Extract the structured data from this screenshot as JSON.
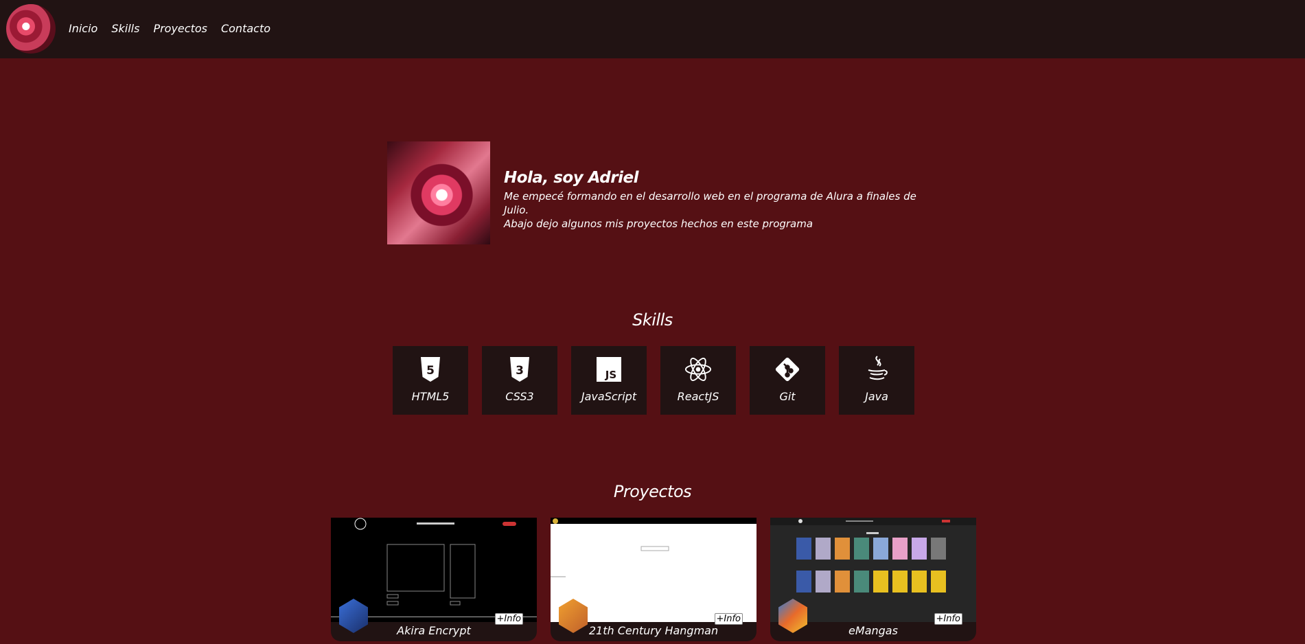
{
  "nav": {
    "links": [
      "Inicio",
      "Skills",
      "Proyectos",
      "Contacto"
    ]
  },
  "hero": {
    "title": "Hola, soy Adriel",
    "line1": "Me empecé formando en el desarrollo web en el programa de Alura a finales de Julio.",
    "line2": "Abajo dejo algunos mis proyectos hechos en este programa"
  },
  "skills": {
    "title": "Skills",
    "items": [
      {
        "label": "HTML5",
        "icon": "html5-icon"
      },
      {
        "label": "CSS3",
        "icon": "css3-icon"
      },
      {
        "label": "JavaScript",
        "icon": "javascript-icon"
      },
      {
        "label": "ReactJS",
        "icon": "react-icon"
      },
      {
        "label": "Git",
        "icon": "git-icon"
      },
      {
        "label": "Java",
        "icon": "java-icon"
      }
    ]
  },
  "projects": {
    "title": "Proyectos",
    "info_label": "+Info",
    "items": [
      {
        "name": "Akira Encrypt"
      },
      {
        "name": "21th Century Hangman"
      },
      {
        "name": "eMangas"
      }
    ]
  },
  "colors": {
    "background": "#551014",
    "navbar": "#211313",
    "card": "#211313"
  }
}
